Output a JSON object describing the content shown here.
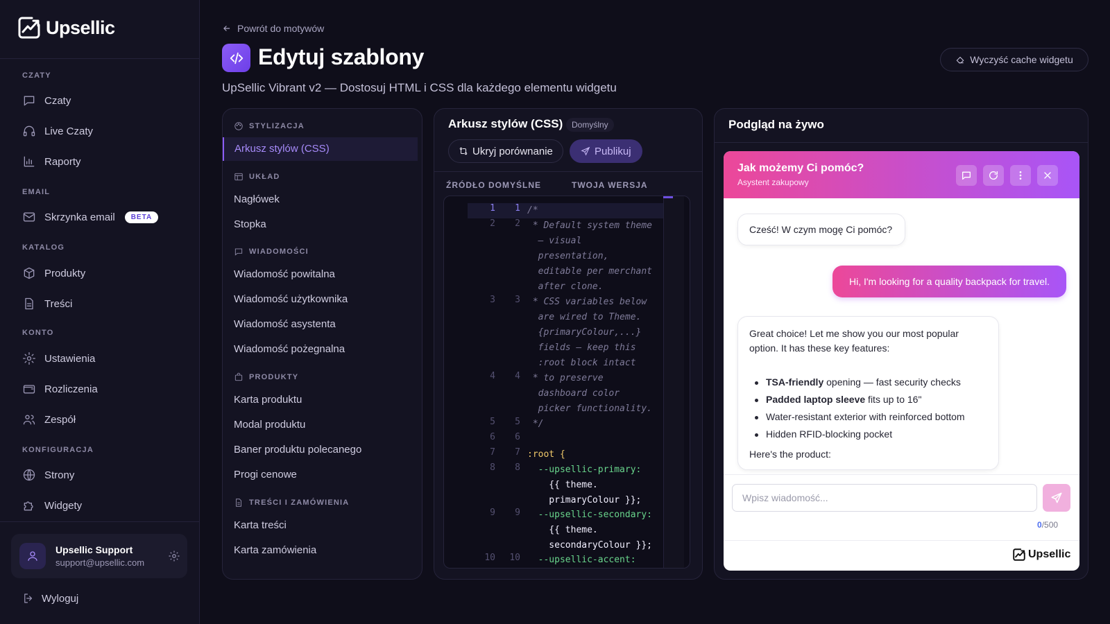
{
  "brand": {
    "name": "Upsellic"
  },
  "sidebar": {
    "sections": {
      "czaty": "CZATY",
      "email": "EMAIL",
      "katalog": "KATALOG",
      "konto": "KONTO",
      "konfiguracja": "KONFIGURACJA"
    },
    "items": {
      "czaty": "Czaty",
      "live": "Live Czaty",
      "raporty": "Raporty",
      "skrzynka": "Skrzynka email",
      "produkty": "Produkty",
      "tresci": "Treści",
      "ustawienia": "Ustawienia",
      "rozliczenia": "Rozliczenia",
      "zespol": "Zespół",
      "strony": "Strony",
      "widgety": "Widgety"
    },
    "beta_badge": "BETA",
    "user": {
      "name": "Upsellic Support",
      "email": "support@upsellic.com"
    },
    "logout": "Wyloguj"
  },
  "header": {
    "back": "Powrót do motywów",
    "title": "Edytuj szablony",
    "subtitle": "UpSellic Vibrant v2 — Dostosuj HTML i CSS dla każdego elementu widgetu",
    "clear_cache": "Wyczyść cache widgetu"
  },
  "templates": {
    "sections": {
      "styl": "STYLIZACJA",
      "uklad": "UKŁAD",
      "wiad": "WIADOMOŚCI",
      "prod": "PRODUKTY",
      "tresci": "TREŚCI I ZAMÓWIENIA"
    },
    "items": {
      "css": "Arkusz stylów (CSS)",
      "naglowek": "Nagłówek",
      "stopka": "Stopka",
      "powitalna": "Wiadomość powitalna",
      "uzytkownika": "Wiadomość użytkownika",
      "asystenta": "Wiadomość asystenta",
      "pozegnalna": "Wiadomość pożegnalna",
      "karta_produktu": "Karta produktu",
      "modal": "Modal produktu",
      "baner": "Baner produktu polecanego",
      "progi": "Progi cenowe",
      "karta_tresci": "Karta treści",
      "karta_zamowienia": "Karta zamówienia"
    }
  },
  "editor": {
    "title": "Arkusz stylów (CSS)",
    "badge": "Domyślny",
    "hide_compare": "Ukryj porównanie",
    "publish": "Publikuj",
    "col_default": "ŹRÓDŁO DOMYŚLNE",
    "col_yours": "TWOJA WERSJA",
    "lines": [
      {
        "n": "1",
        "text": "/*"
      },
      {
        "n": "2",
        "text": " * Default system theme\n  — visual\n  presentation,\n  editable per merchant\n  after clone."
      },
      {
        "n": "3",
        "text": " * CSS variables below\n  are wired to Theme.\n  {primaryColour,...}\n  fields — keep this\n  :root block intact"
      },
      {
        "n": "4",
        "text": " * to preserve\n  dashboard color\n  picker functionality."
      },
      {
        "n": "5",
        "text": " */"
      },
      {
        "n": "6",
        "text": ""
      },
      {
        "n": "7",
        "text": ":root {"
      },
      {
        "n": "8",
        "prop": "  --upsellic-primary:",
        "val": "    {{ theme.\n    primaryColour }};"
      },
      {
        "n": "9",
        "prop": "  --upsellic-secondary:",
        "val": "    {{ theme.\n    secondaryColour }};"
      },
      {
        "n": "10",
        "prop": "  --upsellic-accent:",
        "val": ""
      }
    ]
  },
  "preview": {
    "title": "Podgląd na żywo",
    "widget_title": "Jak możemy Ci pomóc?",
    "widget_subtitle": "Asystent zakupowy",
    "greeting": "Cześć! W czym mogę Ci pomóc?",
    "user_message": "Hi, I'm looking for a quality backpack for travel.",
    "bot_intro": "Great choice! Let me show you our most popular option. It has these key features:",
    "features": [
      {
        "bold": "TSA-friendly",
        "rest": " opening — fast security checks"
      },
      {
        "bold": "Padded laptop sleeve",
        "rest": " fits up to 16\""
      },
      {
        "bold": "",
        "rest": "Water-resistant exterior with reinforced bottom"
      },
      {
        "bold": "",
        "rest": "Hidden RFID-blocking pocket"
      }
    ],
    "bot_outro": "Here's the product:",
    "input_placeholder": "Wpisz wiadomość...",
    "counter_current": "0",
    "counter_max": "/500",
    "footer_brand": "Upsellic"
  },
  "colors": {
    "accent": "#8b5cf6",
    "gradient_start": "#ec4899",
    "gradient_end": "#a855f7"
  }
}
